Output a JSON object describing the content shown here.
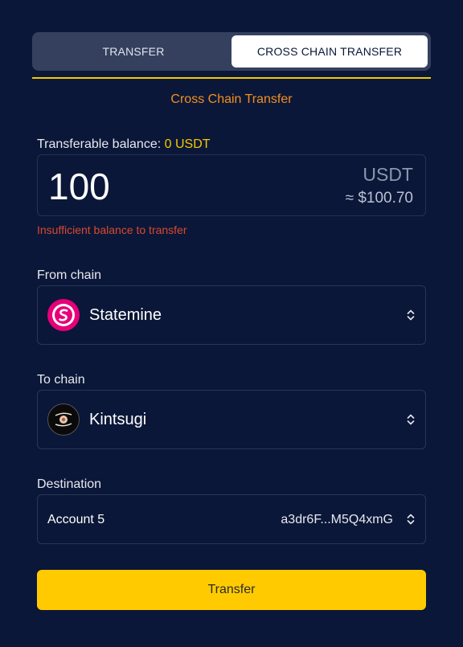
{
  "tabs": [
    {
      "label": "TRANSFER",
      "active": false
    },
    {
      "label": "CROSS CHAIN TRANSFER",
      "active": true
    }
  ],
  "section_title": "Cross Chain Transfer",
  "balance": {
    "label": "Transferable balance:",
    "value": "0 USDT"
  },
  "amount": {
    "value": "100",
    "unit": "USDT",
    "usd": "≈ $100.70"
  },
  "error": "Insufficient balance to transfer",
  "from_chain": {
    "label": "From chain",
    "name": "Statemine",
    "icon": "statemine-logo-icon"
  },
  "to_chain": {
    "label": "To chain",
    "name": "Kintsugi",
    "icon": "kintsugi-logo-icon"
  },
  "destination": {
    "label": "Destination",
    "account_name": "Account 5",
    "address": "a3dr6F...M5Q4xmG"
  },
  "transfer_button": "Transfer",
  "colors": {
    "background": "#0b1738",
    "accent": "#ffcb00",
    "title": "#f28f21",
    "error": "#d9482f",
    "statemine": "#e6007a"
  }
}
